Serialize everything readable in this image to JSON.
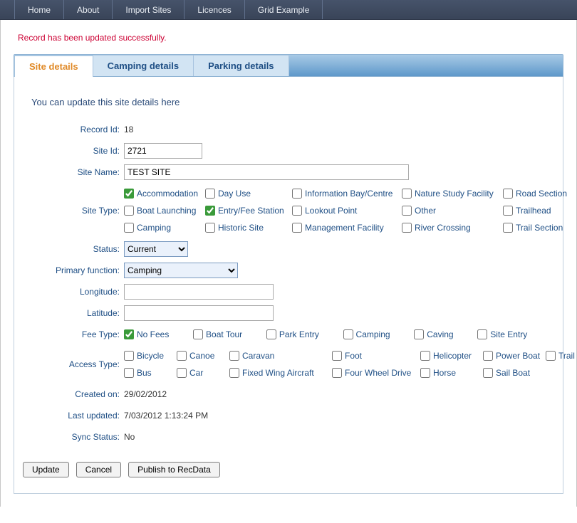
{
  "nav": {
    "items": [
      "Home",
      "About",
      "Import Sites",
      "Licences",
      "Grid Example"
    ]
  },
  "status_message": "Record has been updated successfully.",
  "tabs": [
    {
      "label": "Site details",
      "active": true
    },
    {
      "label": "Camping details",
      "active": false
    },
    {
      "label": "Parking details",
      "active": false
    }
  ],
  "panel": {
    "instruction": "You can update this site details here",
    "record_id_label": "Record Id:",
    "record_id_value": "18",
    "site_id_label": "Site Id:",
    "site_id_value": "2721",
    "site_name_label": "Site Name:",
    "site_name_value": "TEST SITE",
    "site_type_label": "Site Type:",
    "site_type_options": [
      {
        "label": "Accommodation",
        "checked": true
      },
      {
        "label": "Day Use",
        "checked": false
      },
      {
        "label": "Information Bay/Centre",
        "checked": false
      },
      {
        "label": "Nature Study Facility",
        "checked": false
      },
      {
        "label": "Road Section",
        "checked": false
      },
      {
        "label": "Boat Launching",
        "checked": false
      },
      {
        "label": "Entry/Fee Station",
        "checked": true
      },
      {
        "label": "Lookout Point",
        "checked": false
      },
      {
        "label": "Other",
        "checked": false
      },
      {
        "label": "Trailhead",
        "checked": false
      },
      {
        "label": "Camping",
        "checked": false
      },
      {
        "label": "Historic Site",
        "checked": false
      },
      {
        "label": "Management Facility",
        "checked": false
      },
      {
        "label": "River Crossing",
        "checked": false
      },
      {
        "label": "Trail Section",
        "checked": false
      }
    ],
    "status_label": "Status:",
    "status_value": "Current",
    "primary_fn_label": "Primary function:",
    "primary_fn_value": "Camping",
    "longitude_label": "Longitude:",
    "longitude_value": "",
    "latitude_label": "Latitude:",
    "latitude_value": "",
    "fee_type_label": "Fee Type:",
    "fee_type_options": [
      {
        "label": "No Fees",
        "checked": true
      },
      {
        "label": "Boat Tour",
        "checked": false
      },
      {
        "label": "Park Entry",
        "checked": false
      },
      {
        "label": "Camping",
        "checked": false
      },
      {
        "label": "Caving",
        "checked": false
      },
      {
        "label": "Site Entry",
        "checked": false
      }
    ],
    "access_type_label": "Access Type:",
    "access_type_options": [
      {
        "label": "Bicycle",
        "checked": false
      },
      {
        "label": "Canoe",
        "checked": false
      },
      {
        "label": "Caravan",
        "checked": false
      },
      {
        "label": "Foot",
        "checked": false
      },
      {
        "label": "Helicopter",
        "checked": false
      },
      {
        "label": "Power Boat",
        "checked": false
      },
      {
        "label": "Trail Bike",
        "checked": false
      },
      {
        "label": "Bus",
        "checked": false
      },
      {
        "label": "Car",
        "checked": false
      },
      {
        "label": "Fixed Wing Aircraft",
        "checked": false
      },
      {
        "label": "Four Wheel Drive",
        "checked": false
      },
      {
        "label": "Horse",
        "checked": false
      },
      {
        "label": "Sail Boat",
        "checked": false
      },
      {
        "label": "",
        "checked": null
      }
    ],
    "created_on_label": "Created on:",
    "created_on_value": "29/02/2012",
    "last_updated_label": "Last updated:",
    "last_updated_value": "7/03/2012 1:13:24 PM",
    "sync_status_label": "Sync Status:",
    "sync_status_value": "No"
  },
  "buttons": {
    "update": "Update",
    "cancel": "Cancel",
    "publish": "Publish to RecData"
  }
}
